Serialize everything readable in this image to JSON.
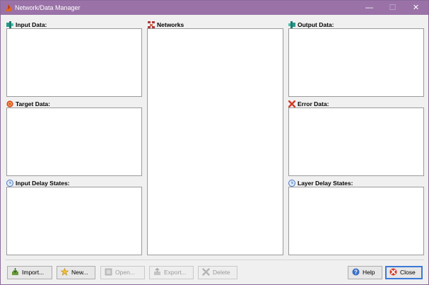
{
  "window": {
    "title": "Network/Data Manager",
    "controls": {
      "minimize": "—",
      "maximize": "☐",
      "close": "✕"
    }
  },
  "panels": {
    "input_data": "Input Data:",
    "target_data": "Target Data:",
    "input_delay_states": "Input Delay States:",
    "networks": "Networks",
    "output_data": "Output Data:",
    "error_data": "Error Data:",
    "layer_delay_states": "Layer Delay States:"
  },
  "buttons": {
    "import": "Import...",
    "new": "New...",
    "open": "Open...",
    "export": "Export...",
    "delete": "Delete",
    "help": "Help",
    "close": "Close"
  }
}
